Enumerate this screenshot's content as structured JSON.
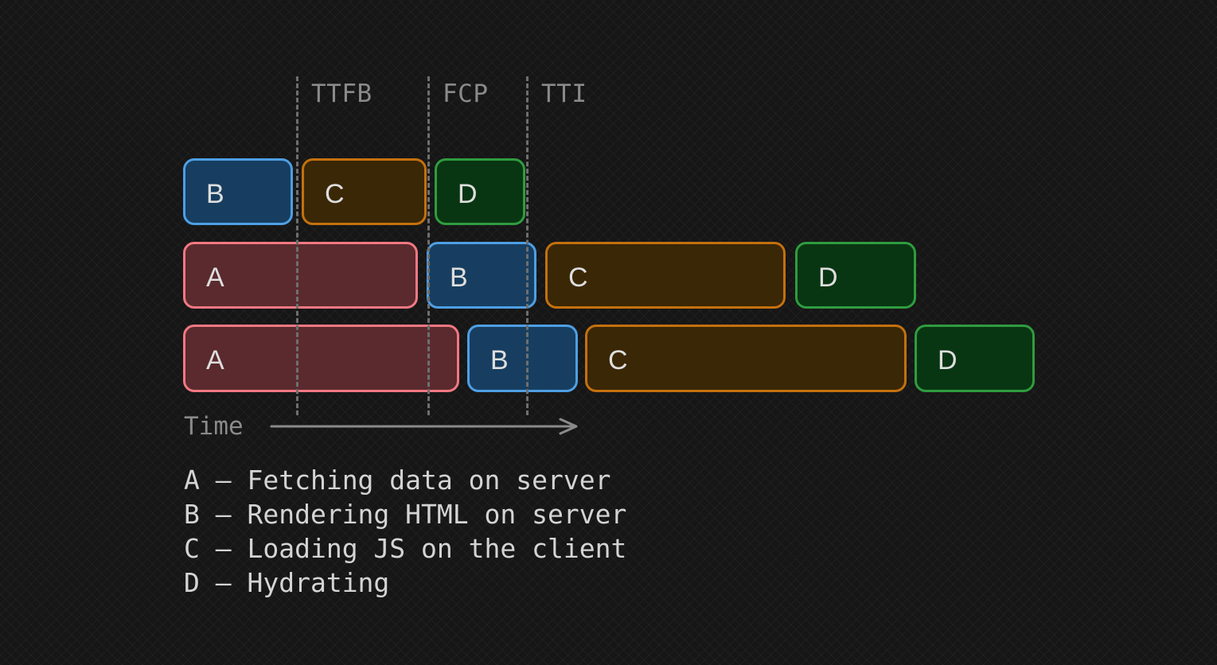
{
  "markers": [
    {
      "id": "ttfb",
      "label": "TTFB"
    },
    {
      "id": "fcp",
      "label": "FCP"
    },
    {
      "id": "tti",
      "label": "TTI"
    }
  ],
  "rows": [
    {
      "blocks": [
        {
          "label": "B"
        },
        {
          "label": "C"
        },
        {
          "label": "D"
        }
      ]
    },
    {
      "blocks": [
        {
          "label": "A"
        },
        {
          "label": "B"
        },
        {
          "label": "C"
        },
        {
          "label": "D"
        }
      ]
    },
    {
      "blocks": [
        {
          "label": "A"
        },
        {
          "label": "B"
        },
        {
          "label": "C"
        },
        {
          "label": "D"
        }
      ]
    }
  ],
  "axis": {
    "label": "Time"
  },
  "legend": [
    {
      "key": "A",
      "sep": " – ",
      "text": "Fetching data on server"
    },
    {
      "key": "B",
      "sep": " – ",
      "text": "Rendering HTML on server"
    },
    {
      "key": "C",
      "sep": " – ",
      "text": "Loading JS on the client"
    },
    {
      "key": "D",
      "sep": " – ",
      "text": "Hydrating"
    }
  ],
  "colors": {
    "A": {
      "fill": "#5a2a2e",
      "stroke": "#f27882"
    },
    "B": {
      "fill": "#173e60",
      "stroke": "#4e9fe4"
    },
    "C": {
      "fill": "#3a2706",
      "stroke": "#c4700e"
    },
    "D": {
      "fill": "#093612",
      "stroke": "#2f9c3f"
    },
    "marker": "#6f6f6f",
    "background": "#161616"
  }
}
